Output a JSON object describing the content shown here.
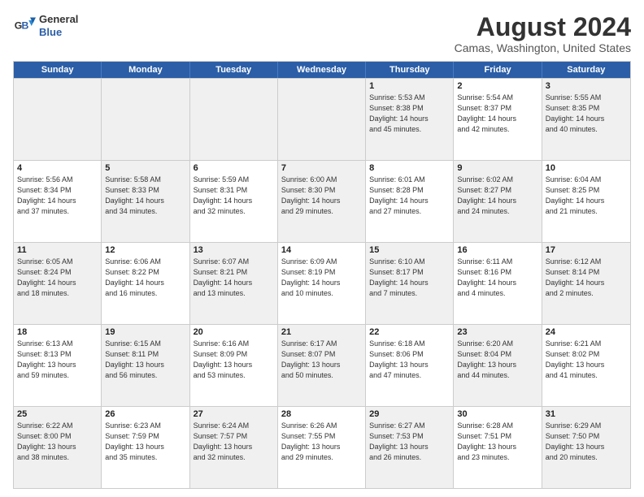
{
  "logo": {
    "line1": "General",
    "line2": "Blue"
  },
  "title": "August 2024",
  "subtitle": "Camas, Washington, United States",
  "header_days": [
    "Sunday",
    "Monday",
    "Tuesday",
    "Wednesday",
    "Thursday",
    "Friday",
    "Saturday"
  ],
  "rows": [
    [
      {
        "day": "",
        "empty": true
      },
      {
        "day": "",
        "empty": true
      },
      {
        "day": "",
        "empty": true
      },
      {
        "day": "",
        "empty": true
      },
      {
        "day": "1",
        "info": "Sunrise: 5:53 AM\nSunset: 8:38 PM\nDaylight: 14 hours\nand 45 minutes."
      },
      {
        "day": "2",
        "info": "Sunrise: 5:54 AM\nSunset: 8:37 PM\nDaylight: 14 hours\nand 42 minutes."
      },
      {
        "day": "3",
        "info": "Sunrise: 5:55 AM\nSunset: 8:35 PM\nDaylight: 14 hours\nand 40 minutes."
      }
    ],
    [
      {
        "day": "4",
        "info": "Sunrise: 5:56 AM\nSunset: 8:34 PM\nDaylight: 14 hours\nand 37 minutes."
      },
      {
        "day": "5",
        "info": "Sunrise: 5:58 AM\nSunset: 8:33 PM\nDaylight: 14 hours\nand 34 minutes."
      },
      {
        "day": "6",
        "info": "Sunrise: 5:59 AM\nSunset: 8:31 PM\nDaylight: 14 hours\nand 32 minutes."
      },
      {
        "day": "7",
        "info": "Sunrise: 6:00 AM\nSunset: 8:30 PM\nDaylight: 14 hours\nand 29 minutes."
      },
      {
        "day": "8",
        "info": "Sunrise: 6:01 AM\nSunset: 8:28 PM\nDaylight: 14 hours\nand 27 minutes."
      },
      {
        "day": "9",
        "info": "Sunrise: 6:02 AM\nSunset: 8:27 PM\nDaylight: 14 hours\nand 24 minutes."
      },
      {
        "day": "10",
        "info": "Sunrise: 6:04 AM\nSunset: 8:25 PM\nDaylight: 14 hours\nand 21 minutes."
      }
    ],
    [
      {
        "day": "11",
        "info": "Sunrise: 6:05 AM\nSunset: 8:24 PM\nDaylight: 14 hours\nand 18 minutes."
      },
      {
        "day": "12",
        "info": "Sunrise: 6:06 AM\nSunset: 8:22 PM\nDaylight: 14 hours\nand 16 minutes."
      },
      {
        "day": "13",
        "info": "Sunrise: 6:07 AM\nSunset: 8:21 PM\nDaylight: 14 hours\nand 13 minutes."
      },
      {
        "day": "14",
        "info": "Sunrise: 6:09 AM\nSunset: 8:19 PM\nDaylight: 14 hours\nand 10 minutes."
      },
      {
        "day": "15",
        "info": "Sunrise: 6:10 AM\nSunset: 8:17 PM\nDaylight: 14 hours\nand 7 minutes."
      },
      {
        "day": "16",
        "info": "Sunrise: 6:11 AM\nSunset: 8:16 PM\nDaylight: 14 hours\nand 4 minutes."
      },
      {
        "day": "17",
        "info": "Sunrise: 6:12 AM\nSunset: 8:14 PM\nDaylight: 14 hours\nand 2 minutes."
      }
    ],
    [
      {
        "day": "18",
        "info": "Sunrise: 6:13 AM\nSunset: 8:13 PM\nDaylight: 13 hours\nand 59 minutes."
      },
      {
        "day": "19",
        "info": "Sunrise: 6:15 AM\nSunset: 8:11 PM\nDaylight: 13 hours\nand 56 minutes."
      },
      {
        "day": "20",
        "info": "Sunrise: 6:16 AM\nSunset: 8:09 PM\nDaylight: 13 hours\nand 53 minutes."
      },
      {
        "day": "21",
        "info": "Sunrise: 6:17 AM\nSunset: 8:07 PM\nDaylight: 13 hours\nand 50 minutes."
      },
      {
        "day": "22",
        "info": "Sunrise: 6:18 AM\nSunset: 8:06 PM\nDaylight: 13 hours\nand 47 minutes."
      },
      {
        "day": "23",
        "info": "Sunrise: 6:20 AM\nSunset: 8:04 PM\nDaylight: 13 hours\nand 44 minutes."
      },
      {
        "day": "24",
        "info": "Sunrise: 6:21 AM\nSunset: 8:02 PM\nDaylight: 13 hours\nand 41 minutes."
      }
    ],
    [
      {
        "day": "25",
        "info": "Sunrise: 6:22 AM\nSunset: 8:00 PM\nDaylight: 13 hours\nand 38 minutes."
      },
      {
        "day": "26",
        "info": "Sunrise: 6:23 AM\nSunset: 7:59 PM\nDaylight: 13 hours\nand 35 minutes."
      },
      {
        "day": "27",
        "info": "Sunrise: 6:24 AM\nSunset: 7:57 PM\nDaylight: 13 hours\nand 32 minutes."
      },
      {
        "day": "28",
        "info": "Sunrise: 6:26 AM\nSunset: 7:55 PM\nDaylight: 13 hours\nand 29 minutes."
      },
      {
        "day": "29",
        "info": "Sunrise: 6:27 AM\nSunset: 7:53 PM\nDaylight: 13 hours\nand 26 minutes."
      },
      {
        "day": "30",
        "info": "Sunrise: 6:28 AM\nSunset: 7:51 PM\nDaylight: 13 hours\nand 23 minutes."
      },
      {
        "day": "31",
        "info": "Sunrise: 6:29 AM\nSunset: 7:50 PM\nDaylight: 13 hours\nand 20 minutes."
      }
    ]
  ]
}
